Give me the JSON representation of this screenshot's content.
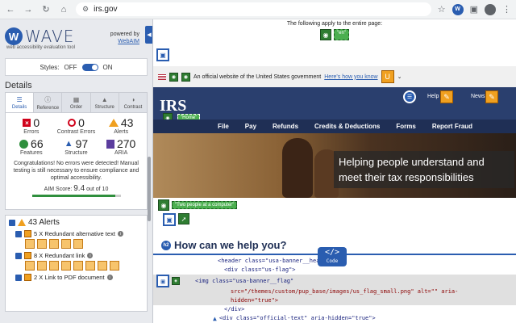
{
  "browser": {
    "url": "irs.gov",
    "ext_label": "W"
  },
  "wave": {
    "logo_letter": "W",
    "logo_text": "WAVE",
    "subtitle": "web accessibility evaluation tool",
    "powered_by": "powered by",
    "webaim": "WebAIM",
    "styles_label": "Styles:",
    "off": "OFF",
    "on": "ON",
    "details_heading": "Details",
    "tabs": [
      "Details",
      "Reference",
      "Order",
      "Structure",
      "Contrast"
    ],
    "stats": [
      {
        "value": "0",
        "label": "Errors"
      },
      {
        "value": "0",
        "label": "Contrast Errors"
      },
      {
        "value": "43",
        "label": "Alerts"
      },
      {
        "value": "66",
        "label": "Features"
      },
      {
        "value": "97",
        "label": "Structure"
      },
      {
        "value": "270",
        "label": "ARIA"
      }
    ],
    "congrats": "Congratulations! No errors were detected! Manual testing is still necessary to ensure compliance and optimal accessibility.",
    "aim_label": "AIM Score:",
    "aim_score": "9.4",
    "aim_suffix": "out of 10",
    "aim_fraction": 0.94,
    "alerts_heading": "43 Alerts",
    "alert_items": [
      "5 X Redundant alternative text",
      "8 X Redundant link",
      "2 X Link to PDF document"
    ]
  },
  "page": {
    "apply_text": "The following apply to the entire page:",
    "lang_tag": "\"en\"",
    "banner_text": "An official website of the United States government",
    "banner_link": "Here's how you know",
    "irs_logo": "IRS",
    "home_tag": "\"Home\"",
    "help": "Help",
    "news": "News",
    "nav": [
      "File",
      "Pay",
      "Refunds",
      "Credits & Deductions",
      "Forms",
      "Report Fraud"
    ],
    "hero_text": "Helping people understand and meet their tax responsibilities",
    "alt_tag": "\"Two people at a computer\"",
    "help_heading": "How can we help you?",
    "code_badge": "Code",
    "code_lines": [
      "<header class=\"usa-banner__header\">",
      "<div class=\"us-flag\">",
      "<img class=\"usa-banner__flag\"",
      "src=\"/themes/custom/pup_base/images/us_flag_small.png\" alt=\"\" aria-",
      "hidden=\"true\">",
      "</div>",
      "<div class=\"official-text\" aria-hidden=\"true\">"
    ]
  }
}
